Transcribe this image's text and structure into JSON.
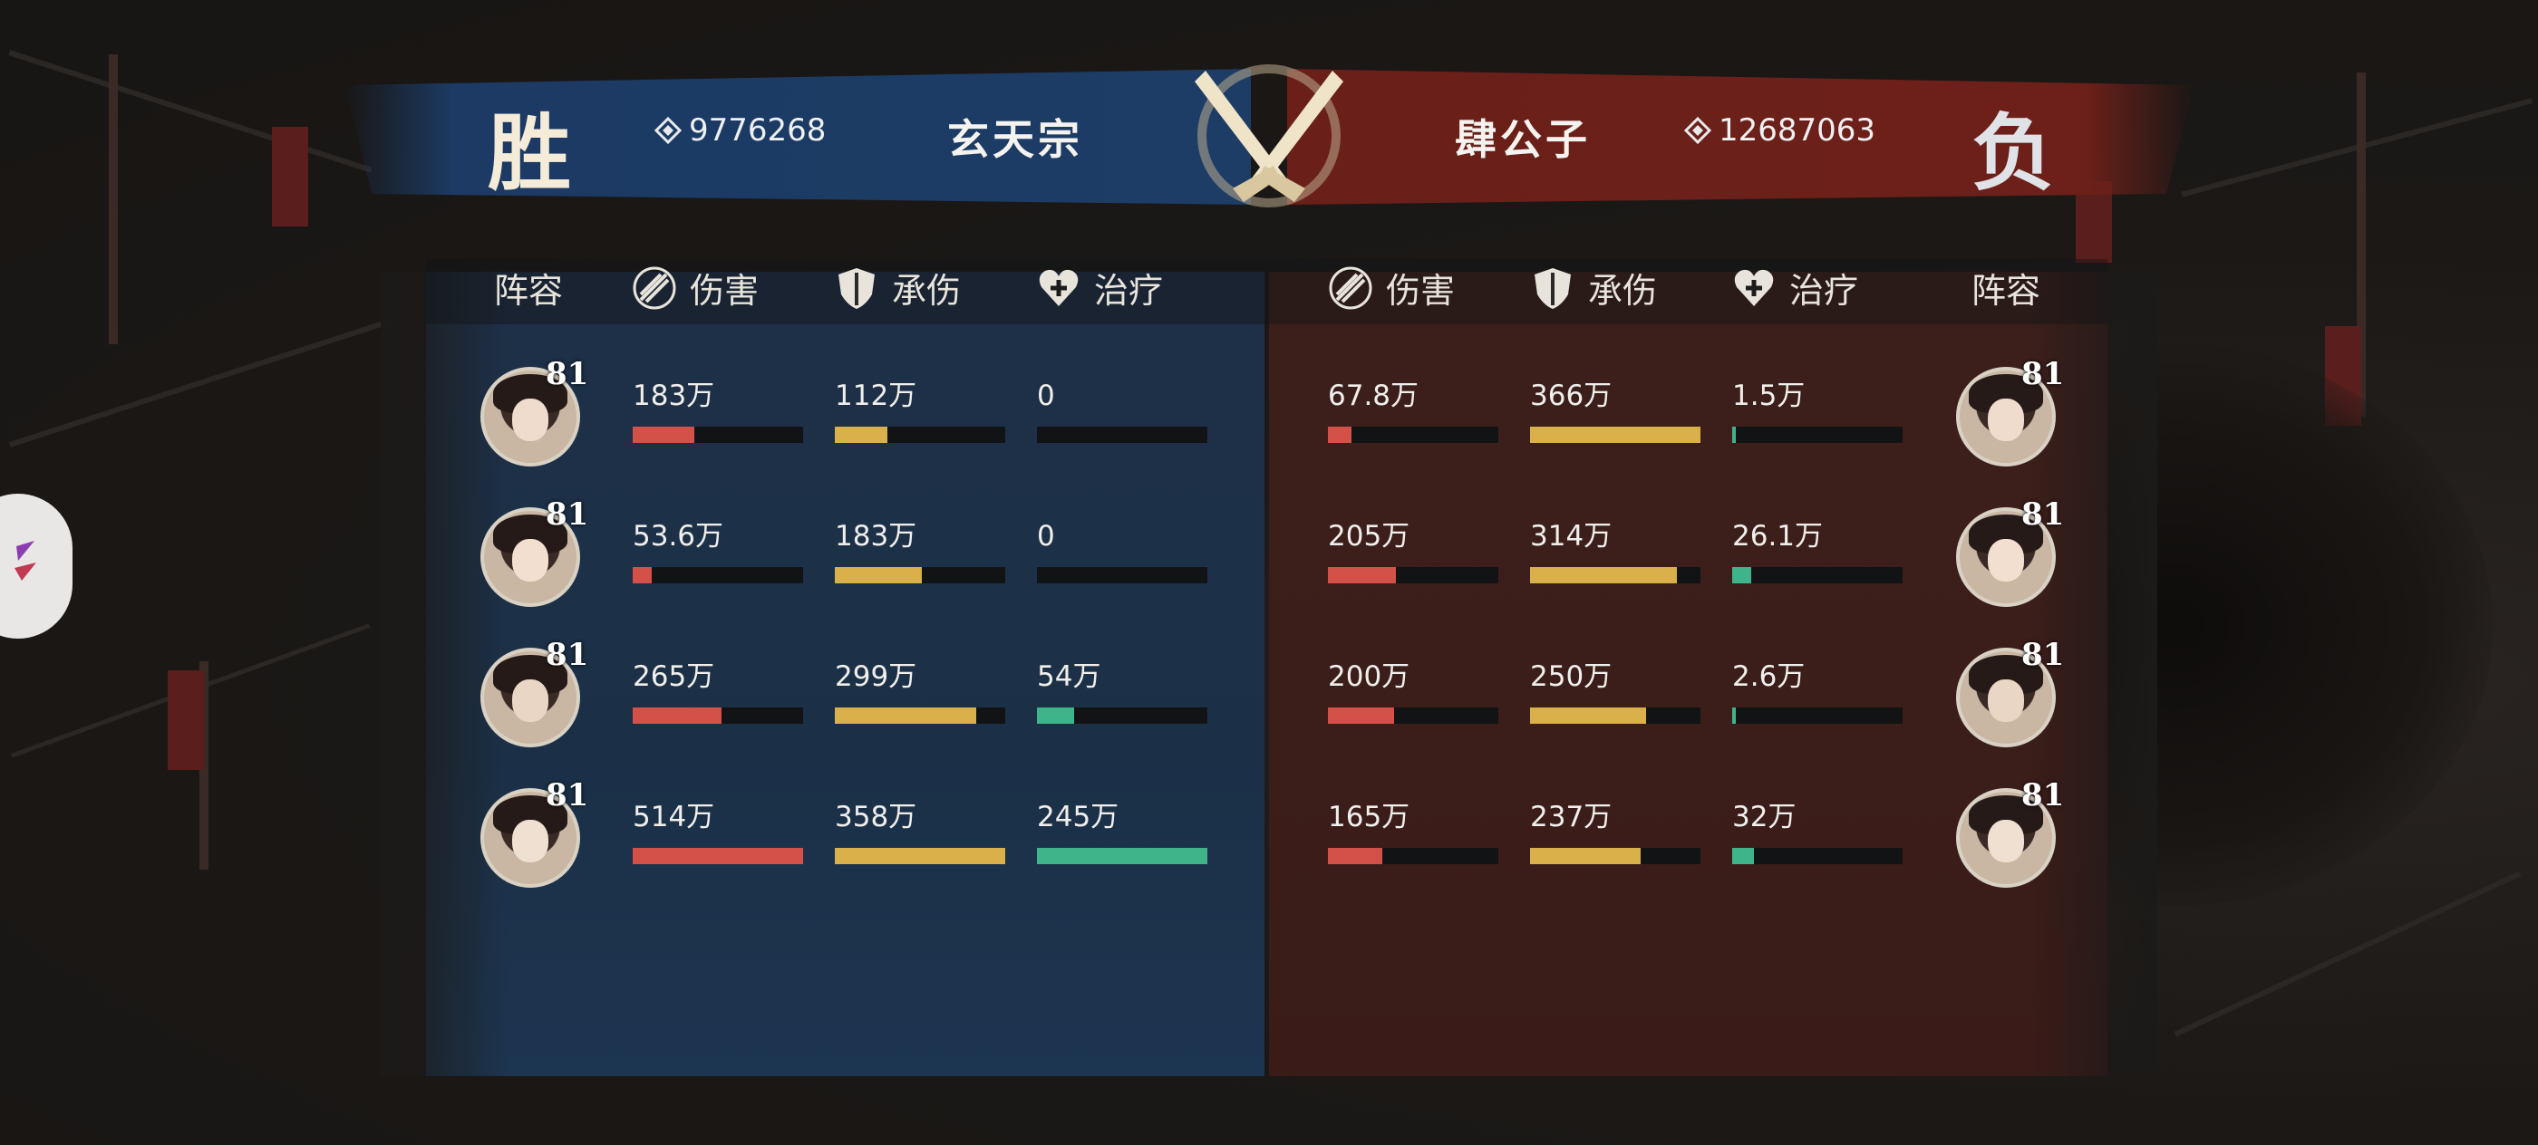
{
  "colors": {
    "damage": "#d4514a",
    "taken": "#d9b04a",
    "heal": "#3fb48a",
    "winner_panel": "#1d3d66",
    "loser_panel": "#6a1f19"
  },
  "left_team": {
    "result": "胜",
    "power": "9776268",
    "name": "玄天宗"
  },
  "right_team": {
    "result": "负",
    "power": "12687063",
    "name": "肆公子"
  },
  "headers": {
    "lineup": "阵容",
    "damage": "伤害",
    "taken": "承伤",
    "heal": "治疗"
  },
  "left_rows": [
    {
      "level": "81",
      "damage": "183万",
      "damage_pct": 0.36,
      "taken": "112万",
      "taken_pct": 0.31,
      "heal": "0",
      "heal_pct": 0.0
    },
    {
      "level": "81",
      "damage": "53.6万",
      "damage_pct": 0.11,
      "taken": "183万",
      "taken_pct": 0.51,
      "heal": "0",
      "heal_pct": 0.0
    },
    {
      "level": "81",
      "damage": "265万",
      "damage_pct": 0.52,
      "taken": "299万",
      "taken_pct": 0.83,
      "heal": "54万",
      "heal_pct": 0.22
    },
    {
      "level": "81",
      "damage": "514万",
      "damage_pct": 1.0,
      "taken": "358万",
      "taken_pct": 1.0,
      "heal": "245万",
      "heal_pct": 1.0
    }
  ],
  "right_rows": [
    {
      "level": "81",
      "damage": "67.8万",
      "damage_pct": 0.14,
      "taken": "366万",
      "taken_pct": 1.0,
      "heal": "1.5万",
      "heal_pct": 0.01
    },
    {
      "level": "81",
      "damage": "205万",
      "damage_pct": 0.4,
      "taken": "314万",
      "taken_pct": 0.86,
      "heal": "26.1万",
      "heal_pct": 0.11
    },
    {
      "level": "81",
      "damage": "200万",
      "damage_pct": 0.39,
      "taken": "250万",
      "taken_pct": 0.68,
      "heal": "2.6万",
      "heal_pct": 0.01
    },
    {
      "level": "81",
      "damage": "165万",
      "damage_pct": 0.32,
      "taken": "237万",
      "taken_pct": 0.65,
      "heal": "32万",
      "heal_pct": 0.13
    }
  ]
}
